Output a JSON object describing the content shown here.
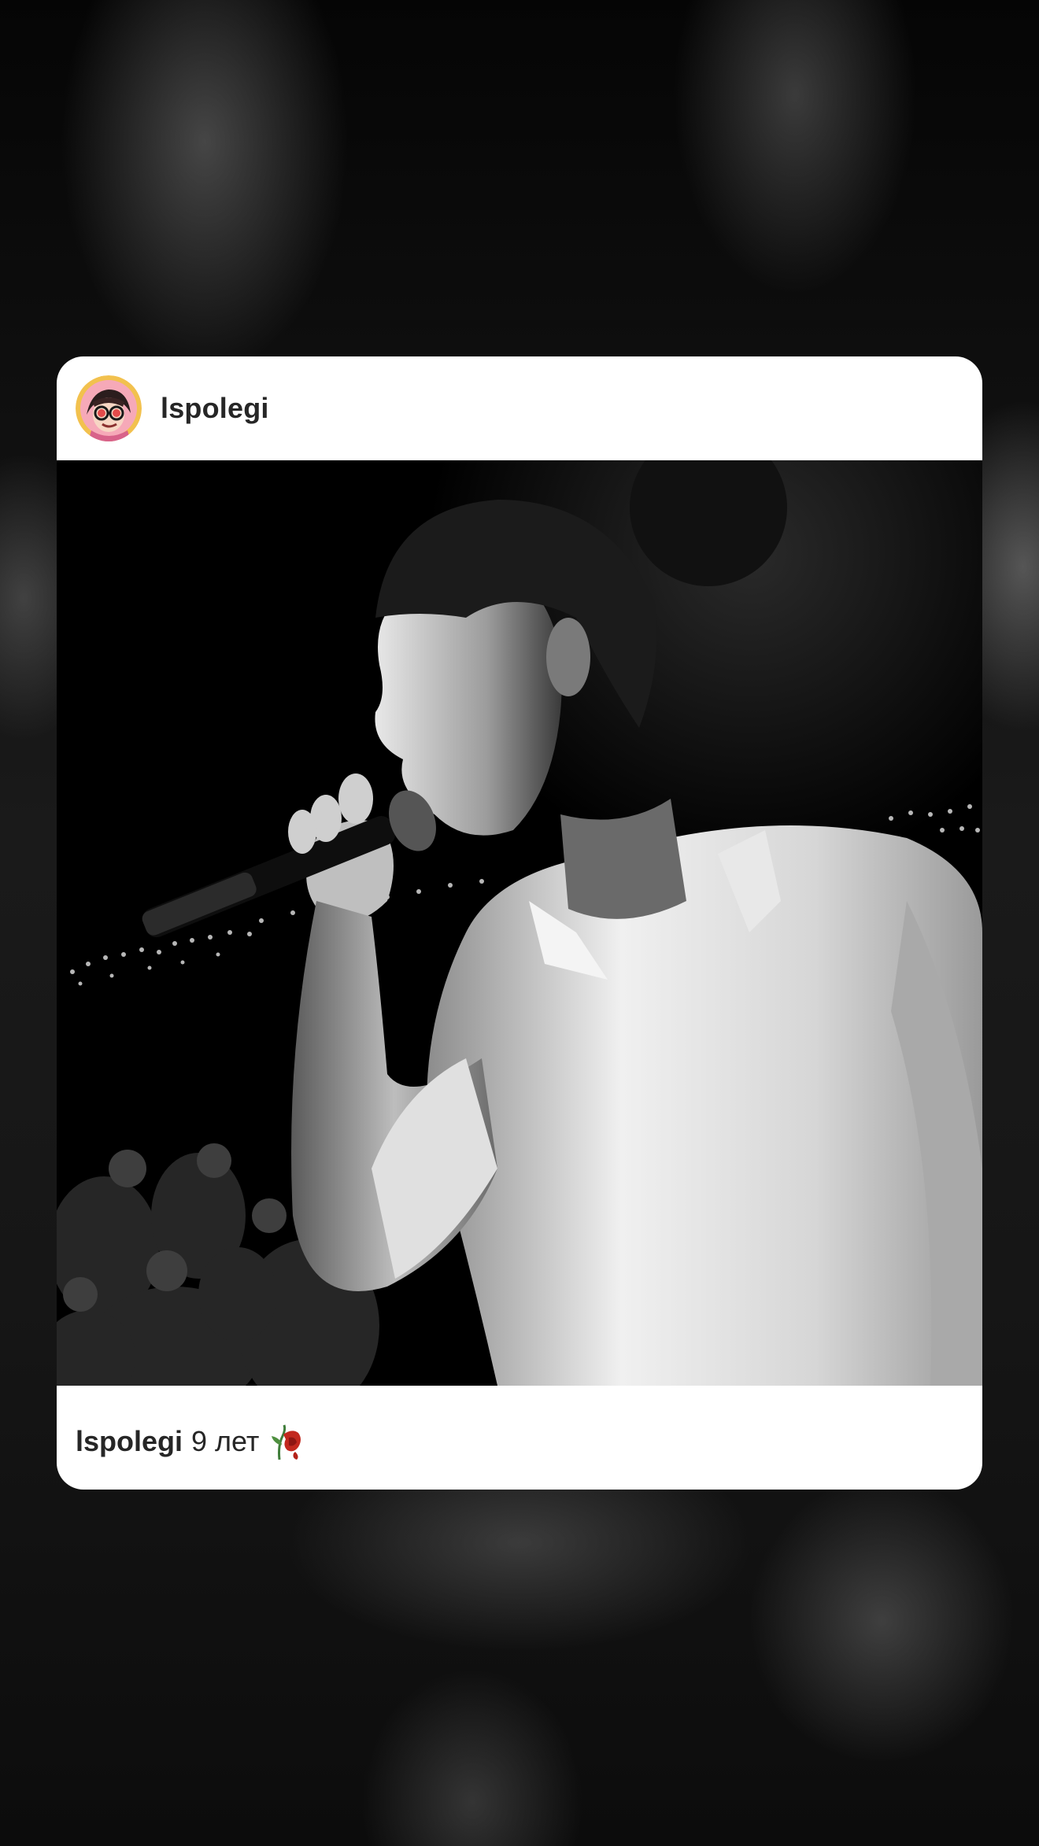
{
  "post": {
    "author": {
      "username": "lspolegi",
      "avatar_icon": "avatar-cartoon-sunglasses"
    },
    "photo": {
      "description_icon": "concert-singer-photo",
      "style": "black-and-white"
    },
    "caption": {
      "username": "lspolegi",
      "text": "9 лет",
      "emoji_icon": "wilted-rose-icon"
    }
  },
  "colors": {
    "card_background": "#ffffff",
    "text_primary": "#262626",
    "backdrop": "#0d0d0d"
  }
}
